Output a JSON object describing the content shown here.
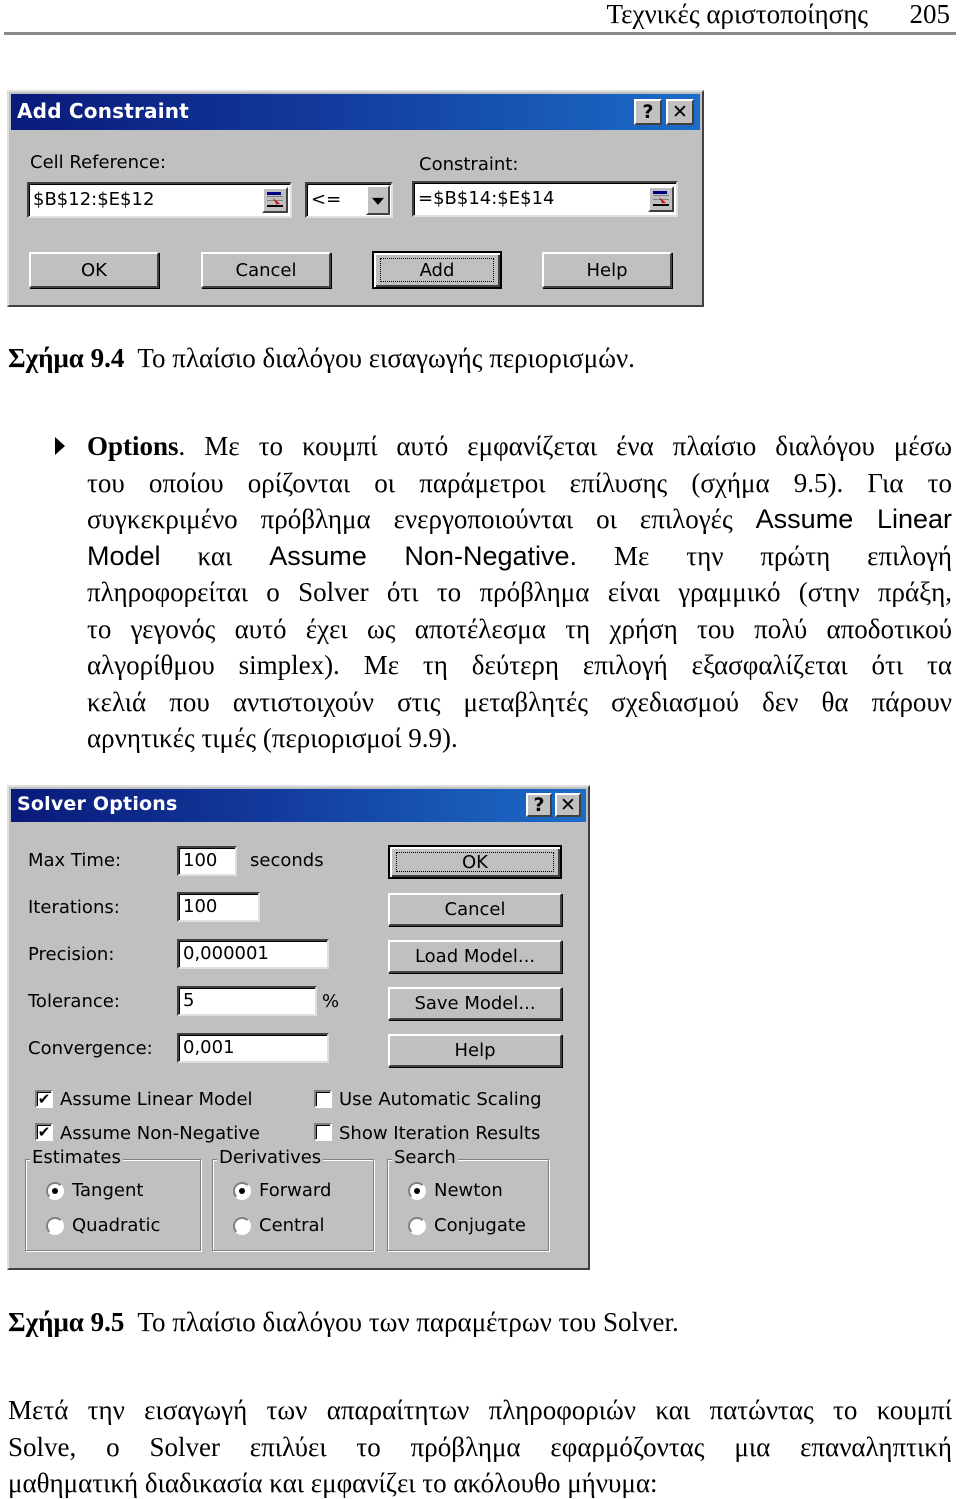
{
  "header": {
    "chapter_title": "Τεχνικές αριστοποίησης",
    "page_number": "205"
  },
  "add_constraint_dialog": {
    "title": "Add Constraint",
    "help_button": "?",
    "close_button": "✕",
    "cell_reference_label": "Cell Reference:",
    "cell_reference_value": "$B$12:$E$12",
    "operator_value": "<=",
    "constraint_label": "Constraint:",
    "constraint_value": "=$B$14:$E$14",
    "buttons": {
      "ok": "OK",
      "cancel": "Cancel",
      "add": "Add",
      "help": "Help"
    }
  },
  "caption_9_4": {
    "label": "Σχήμα 9.4",
    "text": "Το πλαίσιο διαλόγου εισαγωγής περιορισμών."
  },
  "options_paragraph": {
    "bullet_icon": "right-triangle-bullet",
    "lines": [
      {
        "bold": "Options",
        "text": ". Με το κουμπί αυτό εμφανίζεται ένα πλαίσιο διαλόγου μέσω"
      },
      {
        "text": "του οποίου ορίζονται οι παράμετροι επίλυσης (σχήμα 9.5). Για το"
      },
      {
        "text": "συγκεκριμένο πρόβλημα ενεργοποιούνται οι επιλογές ",
        "sans": "Assume Linear"
      },
      {
        "sans": "Model",
        "text": " και ",
        "sans2": "Assume Non-Negative.",
        "text2": " Με την πρώτη επιλογή"
      },
      {
        "text": "πληροφορείται ο Solver ότι το πρόβλημα είναι γραμμικό (στην πράξη,"
      },
      {
        "text": "το γεγονός αυτό έχει ως αποτέλεσμα τη χρήση του πολύ αποδοτικού"
      },
      {
        "text": "αλγορίθμου simplex). Με τη δεύτερη επιλογή εξασφαλίζεται ότι τα"
      },
      {
        "text": "κελιά που αντιστοιχούν στις μεταβλητές σχεδιασμού δεν θα πάρουν"
      },
      {
        "text": "αρνητικές τιμές (περιορισμοί 9.9)."
      }
    ]
  },
  "solver_options_dialog": {
    "title": "Solver Options",
    "help_button": "?",
    "close_button": "✕",
    "fields": {
      "max_time_label": "Max Time:",
      "max_time_value": "100",
      "max_time_unit": "seconds",
      "iterations_label": "Iterations:",
      "iterations_value": "100",
      "precision_label": "Precision:",
      "precision_value": "0,000001",
      "tolerance_label": "Tolerance:",
      "tolerance_value": "5",
      "tolerance_unit": "%",
      "convergence_label": "Convergence:",
      "convergence_value": "0,001"
    },
    "buttons": {
      "ok": "OK",
      "cancel": "Cancel",
      "load_model": "Load Model...",
      "save_model": "Save Model...",
      "help": "Help"
    },
    "checkboxes": {
      "assume_linear_model": {
        "label": "Assume Linear Model",
        "checked": true
      },
      "assume_non_negative": {
        "label": "Assume Non-Negative",
        "checked": true
      },
      "use_automatic_scaling": {
        "label": "Use Automatic Scaling",
        "checked": false
      },
      "show_iteration_results": {
        "label": "Show Iteration Results",
        "checked": false
      }
    },
    "groups": {
      "estimates": {
        "label": "Estimates",
        "options": [
          "Tangent",
          "Quadratic"
        ],
        "selected": "Tangent"
      },
      "derivatives": {
        "label": "Derivatives",
        "options": [
          "Forward",
          "Central"
        ],
        "selected": "Forward"
      },
      "search": {
        "label": "Search",
        "options": [
          "Newton",
          "Conjugate"
        ],
        "selected": "Newton"
      }
    },
    "check_mark": "✔"
  },
  "caption_9_5": {
    "label": "Σχήμα 9.5",
    "text": "Το πλαίσιο διαλόγου των παραμέτρων του Solver."
  },
  "closing_paragraph": {
    "lines": [
      "Μετά την εισαγωγή των απαραίτητων πληροφοριών και πατώντας το κουμπί",
      "Solve, ο Solver επιλύει το πρόβλημα εφαρμόζοντας μια επαναληπτική",
      "μαθηματική διαδικασία και εμφανίζει το ακόλουθο μήνυμα:"
    ]
  }
}
